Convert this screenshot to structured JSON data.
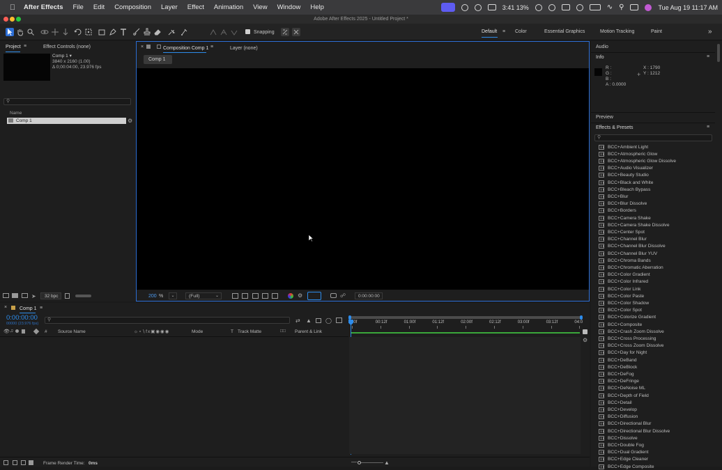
{
  "menubar": {
    "app": "After Effects",
    "items": [
      "File",
      "Edit",
      "Composition",
      "Layer",
      "Effect",
      "Animation",
      "View",
      "Window",
      "Help"
    ],
    "battery_text": "3:41 13%",
    "clock": "Tue Aug 19  11:17 AM"
  },
  "window": {
    "title": "Adobe After Effects 2025 - Untitled Project *"
  },
  "toolbar": {
    "snapping_label": "Snapping",
    "workspaces": [
      "Default",
      "Color",
      "Essential Graphics",
      "Motion Tracking",
      "Paint"
    ],
    "more": "»"
  },
  "project": {
    "tab_project": "Project",
    "tab_effect_controls": "Effect Controls (none)",
    "item_name": "Comp 1 ▾",
    "item_size": "3840 x 2160 (1.00)",
    "item_duration": "Δ 0;00:04:00, 23.976 fps",
    "search_placeholder": "",
    "col_name": "Name",
    "row_comp": "Comp 1",
    "bpc": "32 bpc"
  },
  "composition": {
    "tab": "Composition Comp 1",
    "layer_tab": "Layer (none)",
    "subtab": "Comp 1",
    "zoom": "200",
    "zoom_unit": "%",
    "resolution": "(Full)",
    "timecode": "0:00:00:00"
  },
  "info": {
    "audio_tab": "Audio",
    "title": "Info",
    "r": "R :",
    "g": "G :",
    "b": "B :",
    "a": "A : 0.0000",
    "x": "X : 1790",
    "y": "Y : 1212",
    "preview": "Preview"
  },
  "effects": {
    "title": "Effects & Presets",
    "items": [
      "BCC+Ambient Light",
      "BCC+Atmospheric Glow",
      "BCC+Atmospheric Glow Dissolve",
      "BCC+Audio Visualizer",
      "BCC+Beauty Studio",
      "BCC+Black and White",
      "BCC+Bleach Bypass",
      "BCC+Blur",
      "BCC+Blur Dissolve",
      "BCC+Borders",
      "BCC+Camera Shake",
      "BCC+Camera Shake Dissolve",
      "BCC+Center Spot",
      "BCC+Channel Blur",
      "BCC+Channel Blur Dissolve",
      "BCC+Channel Blur YUV",
      "BCC+Chroma Bands",
      "BCC+Chromatic Aberration",
      "BCC+Color Gradient",
      "BCC+Color Infrared",
      "BCC+Color Link",
      "BCC+Color Paste",
      "BCC+Color Shadow",
      "BCC+Color Spot",
      "BCC+Colorize Gradient",
      "BCC+Composite",
      "BCC+Crash Zoom Dissolve",
      "BCC+Cross Processing",
      "BCC+Cross Zoom Dissolve",
      "BCC+Day for Night",
      "BCC+DeBand",
      "BCC+DeBlock",
      "BCC+DeFog",
      "BCC+DeFringe",
      "BCC+DeNoise ML",
      "BCC+Depth of Field",
      "BCC+Detail",
      "BCC+Develop",
      "BCC+Diffusion",
      "BCC+Directional Blur",
      "BCC+Directional Blur Dissolve",
      "BCC+Dissolve",
      "BCC+Double Fog",
      "BCC+Dual Gradient",
      "BCC+Edge Cleaner",
      "BCC+Edge Composite"
    ]
  },
  "timeline": {
    "tab": "Comp 1",
    "timecode": "0:00:00:00",
    "fps": "00000 (23.976 fps)",
    "col_source": "Source Name",
    "col_mode": "Mode",
    "col_t": "T",
    "col_trackmatte": "Track Matte",
    "col_parent": "Parent & Link",
    "col_hash": "#",
    "ruler": [
      "00f",
      "00:12f",
      "01:00f",
      "01:12f",
      "02:00f",
      "02:12f",
      "03:00f",
      "03:12f",
      "04:0"
    ],
    "render_label": "Frame Render Time:",
    "render_value": "0ms"
  },
  "colors": {
    "accent_blue": "#2d8ceb",
    "render_green": "#3aa83a"
  }
}
